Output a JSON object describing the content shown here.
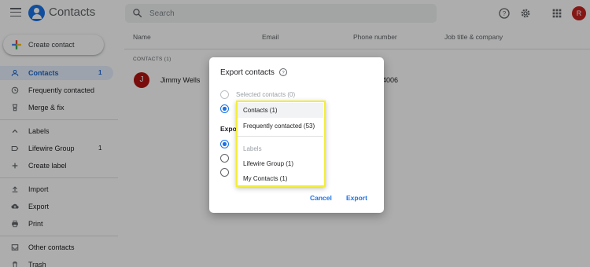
{
  "header": {
    "app_title": "Contacts",
    "search_placeholder": "Search",
    "avatar_initial": "R",
    "icons": [
      "menu-icon",
      "contacts-logo-icon",
      "search-icon",
      "help-icon",
      "settings-icon",
      "apps-grid-icon"
    ]
  },
  "sidebar": {
    "create_label": "Create contact",
    "items": [
      {
        "label": "Contacts",
        "count": "1",
        "icon": "person-icon",
        "active": true
      },
      {
        "label": "Frequently contacted",
        "count": "",
        "icon": "history-icon"
      },
      {
        "label": "Merge & fix",
        "count": "",
        "icon": "merge-icon"
      },
      {
        "label": "Labels",
        "count": "",
        "icon": "chevron-up-icon"
      },
      {
        "label": "Lifewire Group",
        "count": "1",
        "icon": "label-icon"
      },
      {
        "label": "Create label",
        "count": "",
        "icon": "plus-icon"
      },
      {
        "label": "Import",
        "count": "",
        "icon": "upload-icon"
      },
      {
        "label": "Export",
        "count": "",
        "icon": "cloud-download-icon"
      },
      {
        "label": "Print",
        "count": "",
        "icon": "print-icon"
      },
      {
        "label": "Other contacts",
        "count": "",
        "icon": "inbox-icon"
      },
      {
        "label": "Trash",
        "count": "",
        "icon": "trash-icon"
      }
    ]
  },
  "list": {
    "columns": [
      "Name",
      "Email",
      "Phone number",
      "Job title & company"
    ],
    "section_label": "CONTACTS (1)",
    "rows": [
      {
        "initial": "J",
        "name": "Jimmy Wells",
        "phone_partial": "4006"
      }
    ]
  },
  "dialog": {
    "title": "Export contacts",
    "option_selected": "Selected contacts (0)",
    "export_as_partial": "Expo",
    "cancel_label": "Cancel",
    "export_label": "Export",
    "dropdown": {
      "items": [
        "Contacts (1)",
        "Frequently contacted (53)"
      ],
      "labels_header": "Labels",
      "label_items": [
        "Lifewire Group (1)",
        "My Contacts (1)"
      ],
      "highlight_color": "#f3ee3c"
    }
  },
  "colors": {
    "accent": "#1a73e8",
    "active_bg": "#e8f0fe",
    "avatar_header": "#c5221f",
    "avatar_row": "#b31412"
  }
}
